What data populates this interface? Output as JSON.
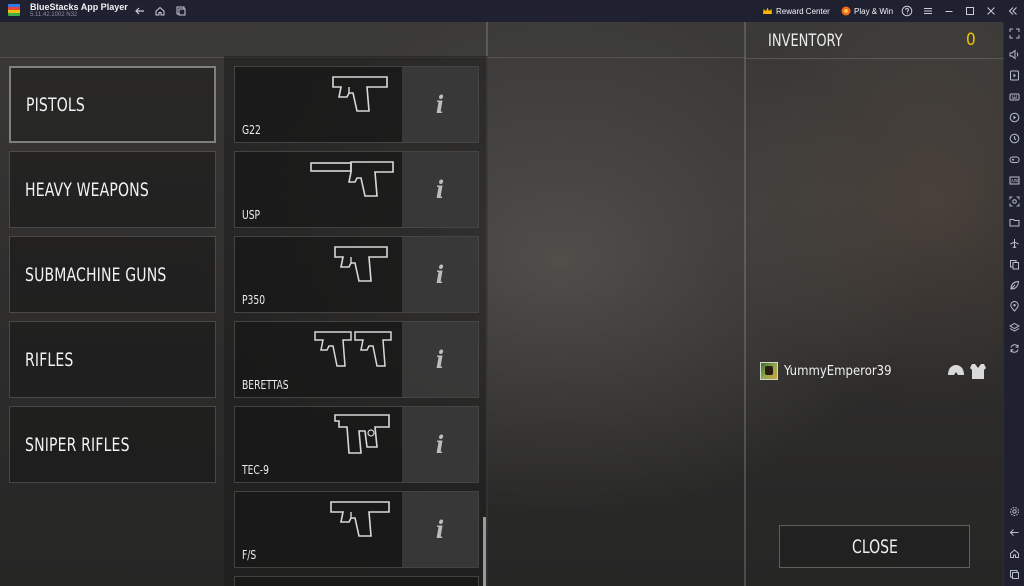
{
  "window": {
    "app_name": "BlueStacks App Player",
    "version": "5.11.42.1002 N32",
    "reward_center_label": "Reward Center",
    "play_win_label": "Play & Win"
  },
  "colors": {
    "titlebar_bg": "#1f2130",
    "inventory_count": "#f2c200",
    "reward_crown": "#f5b400",
    "play_win_dot": "#f26b1d"
  },
  "titlebar_icons": [
    "back-icon",
    "home-icon",
    "multi-instance-icon",
    "crown-icon",
    "coin-icon",
    "help-icon",
    "menu-icon",
    "minimize-icon",
    "maximize-icon",
    "close-icon",
    "collapse-sidebar-icon"
  ],
  "sidebar_icons": [
    "fullscreen-icon",
    "volume-icon",
    "video-icon",
    "keyboard-icon",
    "record-icon",
    "macro-icon",
    "gamepad-icon",
    "apk-icon",
    "screenshot-icon",
    "folder-icon",
    "airplane-icon",
    "copy-icon",
    "eco-mode-icon",
    "location-icon",
    "layers-icon",
    "sync-icon",
    "settings-icon",
    "back-icon",
    "home-icon",
    "recent-apps-icon"
  ],
  "categories": [
    {
      "label": "PISTOLS",
      "active": true
    },
    {
      "label": "HEAVY WEAPONS",
      "active": false
    },
    {
      "label": "SUBMACHINE GUNS",
      "active": false
    },
    {
      "label": "RIFLES",
      "active": false
    },
    {
      "label": "SNIPER RIFLES",
      "active": false
    }
  ],
  "weapons": [
    {
      "name": "G22",
      "icon": "pistol-icon",
      "info": "i"
    },
    {
      "name": "USP",
      "icon": "silenced-pistol-icon",
      "info": "i"
    },
    {
      "name": "P350",
      "icon": "pistol-icon",
      "info": "i"
    },
    {
      "name": "BERETTAS",
      "icon": "dual-pistols-icon",
      "info": "i"
    },
    {
      "name": "TEC-9",
      "icon": "machine-pistol-icon",
      "info": "i"
    },
    {
      "name": "F/S",
      "icon": "pistol-icon",
      "info": "i"
    }
  ],
  "inventory": {
    "title": "INVENTORY",
    "count": "0",
    "player_name": "YummyEmperor39",
    "gear_icons": [
      "helmet-icon",
      "armor-vest-icon"
    ]
  },
  "close_label": "CLOSE"
}
